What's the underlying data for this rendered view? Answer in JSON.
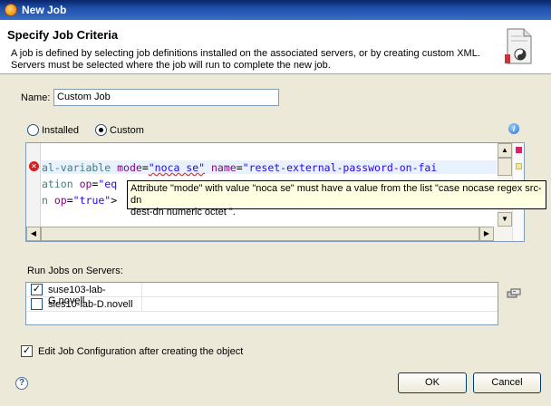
{
  "window": {
    "title": "New Job"
  },
  "banner": {
    "heading": "Specify Job Criteria",
    "description_line1": "A job is defined by selecting job definitions installed on the associated servers, or by creating custom XML.",
    "description_line2": "Servers must be selected where the job will run to complete the new job."
  },
  "form": {
    "name_label": "Name:",
    "name_value": "Custom Job",
    "source_options": [
      {
        "label": "Installed",
        "selected": false
      },
      {
        "label": "Custom",
        "selected": true
      }
    ]
  },
  "editor": {
    "line1": {
      "tag": "al-variable",
      "attr1": "mode",
      "val1": "\"noca se\"",
      "attr2": "name",
      "val2": "\"reset-external-password-on-fai"
    },
    "line2": {
      "tag": "ation",
      "attr1": "op",
      "val1": "\"eq"
    },
    "line3": {
      "tag": "n",
      "attr1": "op",
      "val1": "\"true\"",
      "tail": ">"
    },
    "tooltip_line1": "Attribute \"mode\" with value \"noca se\" must have a value from the list \"case nocase regex src-dn",
    "tooltip_line2": "dest-dn numeric octet \"."
  },
  "servers": {
    "label": "Run Jobs on Servers:",
    "items": [
      {
        "name": "suse103-lab-G.novell",
        "checked": true
      },
      {
        "name": "sles10-lab-D.novell",
        "checked": false
      }
    ]
  },
  "options": {
    "edit_config_label": "Edit Job Configuration after creating the object",
    "edit_config_checked": true
  },
  "buttons": {
    "ok": "OK",
    "cancel": "Cancel"
  },
  "colors": {
    "titlebar": "#0a246a",
    "error": "#d42020",
    "tooltip_bg": "#ffffe1"
  }
}
